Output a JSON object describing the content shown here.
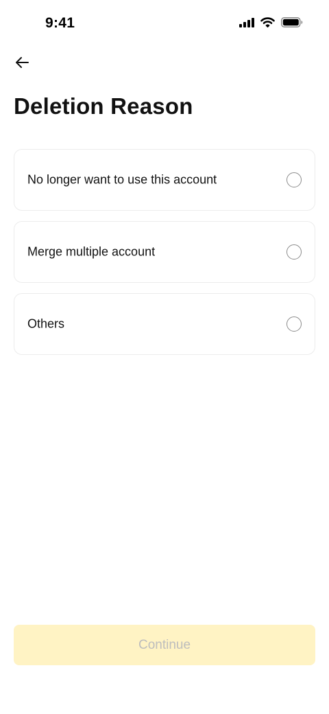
{
  "status_bar": {
    "time": "9:41",
    "icons": [
      "signal-icon",
      "wifi-icon",
      "battery-icon"
    ]
  },
  "header": {
    "back_icon": "arrow-left-icon",
    "title": "Deletion Reason"
  },
  "options": [
    {
      "label": "No longer want to use this account",
      "selected": false
    },
    {
      "label": "Merge multiple account",
      "selected": false
    },
    {
      "label": "Others",
      "selected": false
    }
  ],
  "footer": {
    "continue_label": "Continue",
    "continue_enabled": false
  },
  "colors": {
    "continue_background": "#fff3c4",
    "continue_text": "#bdbdbd",
    "card_border": "#ececec"
  }
}
